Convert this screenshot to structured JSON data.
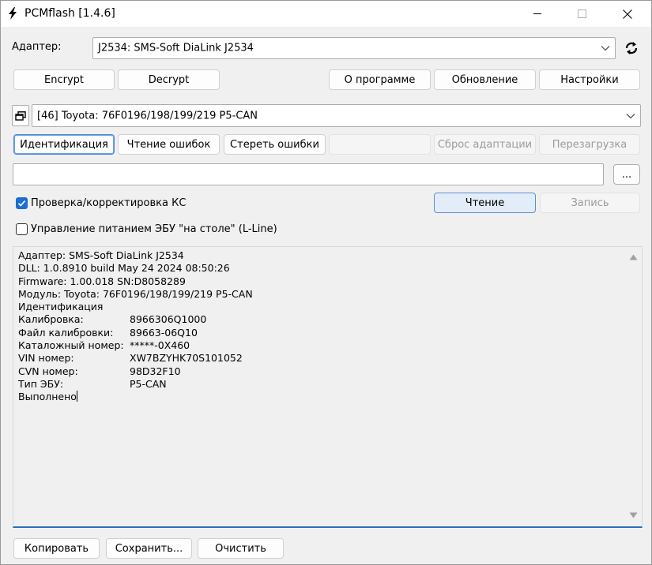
{
  "window": {
    "title": "PCMflash [1.4.6]"
  },
  "adapter": {
    "label": "Адаптер:",
    "value": "J2534: SMS-Soft DiaLink J2534"
  },
  "toolbar": {
    "encrypt": "Encrypt",
    "decrypt": "Decrypt",
    "about": "О программе",
    "update": "Обновление",
    "settings": "Настройки"
  },
  "module": {
    "value": "[46] Toyota: 76F0196/198/199/219 P5-CAN"
  },
  "actions": {
    "identification": "Идентификация",
    "read_errors": "Чтение ошибок",
    "clear_errors": "Стереть ошибки",
    "reset_adaptation": "Сброс адаптации",
    "reboot": "Перезагрузка"
  },
  "file": {
    "path": "",
    "browse": "..."
  },
  "options": {
    "checksum_label": "Проверка/корректировка КС",
    "checksum_checked": true,
    "power_label": "Управление питанием ЭБУ \"на столе\" (L-Line)",
    "power_checked": false,
    "read": "Чтение",
    "write": "Запись"
  },
  "log": {
    "lines": [
      "Адаптер: SMS-Soft DiaLink J2534",
      "DLL: 1.0.8910 build May 24 2024 08:50:26",
      "Firmware: 1.00.018 SN:D8058289",
      "Модуль: Toyota: 76F0196/198/199/219 P5-CAN",
      "Идентификация"
    ],
    "fields": [
      {
        "key": "Калибровка:",
        "value": "8966306Q1000"
      },
      {
        "key": "Файл калибровки:",
        "value": "89663-06Q10"
      },
      {
        "key": "Каталожный номер:",
        "value": "*****-0X460"
      },
      {
        "key": "VIN номер:",
        "value": "XW7BZYHK70S101052"
      },
      {
        "key": "CVN номер:",
        "value": "98D32F10"
      },
      {
        "key": "Тип ЭБУ:",
        "value": "P5-CAN"
      }
    ],
    "status": "Выполнено"
  },
  "bottom": {
    "copy": "Копировать",
    "save": "Сохранить...",
    "clear": "Очистить"
  },
  "colors": {
    "accent": "#1a6ed3",
    "log_underline": "#2a6fb8"
  }
}
